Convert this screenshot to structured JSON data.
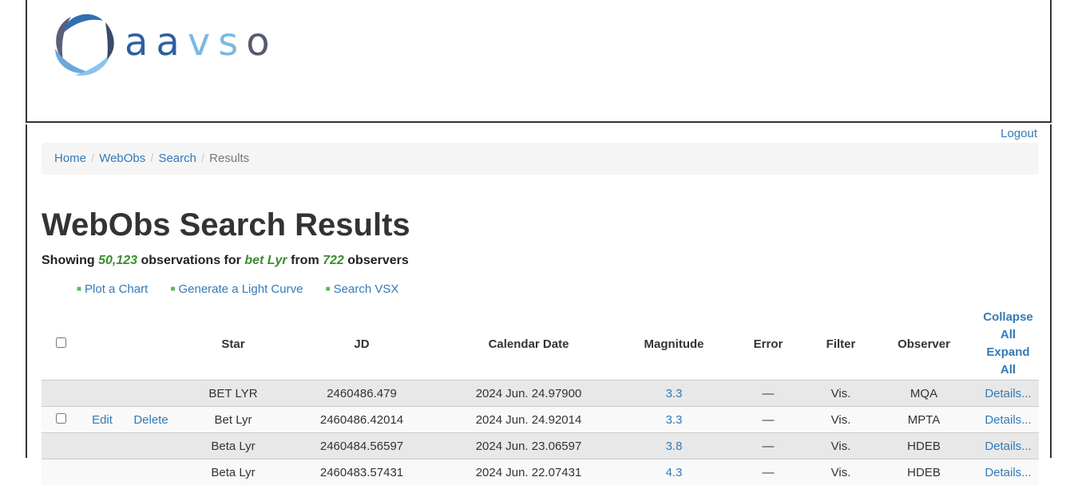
{
  "brand": {
    "name": "aavso"
  },
  "nav": {
    "logout": "Logout"
  },
  "breadcrumb": [
    "Home",
    "WebObs",
    "Search",
    "Results"
  ],
  "page": {
    "title": "WebObs Search Results",
    "summary_prefix": "Showing",
    "obs_count": "50,123",
    "summary_mid1": "observations for",
    "star": "bet Lyr",
    "summary_mid2": "from",
    "observer_count": "722",
    "summary_suffix": "observers"
  },
  "actions": {
    "plot": "Plot a Chart",
    "light_curve": "Generate a Light Curve",
    "vsx": "Search VSX"
  },
  "table": {
    "headers": {
      "star": "Star",
      "jd": "JD",
      "date": "Calendar Date",
      "mag": "Magnitude",
      "error": "Error",
      "filter": "Filter",
      "observer": "Observer",
      "collapse": "Collapse All",
      "expand": "Expand All"
    },
    "rows": [
      {
        "editable": false,
        "star": "BET LYR",
        "jd": "2460486.479",
        "date": "2024 Jun. 24.97900",
        "mag": "3.3",
        "error": "—",
        "filter": "Vis.",
        "observer": "MQA",
        "details": "Details..."
      },
      {
        "editable": true,
        "edit": "Edit",
        "delete": "Delete",
        "star": "Bet Lyr",
        "jd": "2460486.42014",
        "date": "2024 Jun. 24.92014",
        "mag": "3.3",
        "error": "—",
        "filter": "Vis.",
        "observer": "MPTA",
        "details": "Details..."
      },
      {
        "editable": false,
        "star": "Beta Lyr",
        "jd": "2460484.56597",
        "date": "2024 Jun. 23.06597",
        "mag": "3.8",
        "error": "—",
        "filter": "Vis.",
        "observer": "HDEB",
        "details": "Details..."
      },
      {
        "editable": false,
        "star": "Beta Lyr",
        "jd": "2460483.57431",
        "date": "2024 Jun. 22.07431",
        "mag": "4.3",
        "error": "—",
        "filter": "Vis.",
        "observer": "HDEB",
        "details": "Details..."
      }
    ]
  }
}
